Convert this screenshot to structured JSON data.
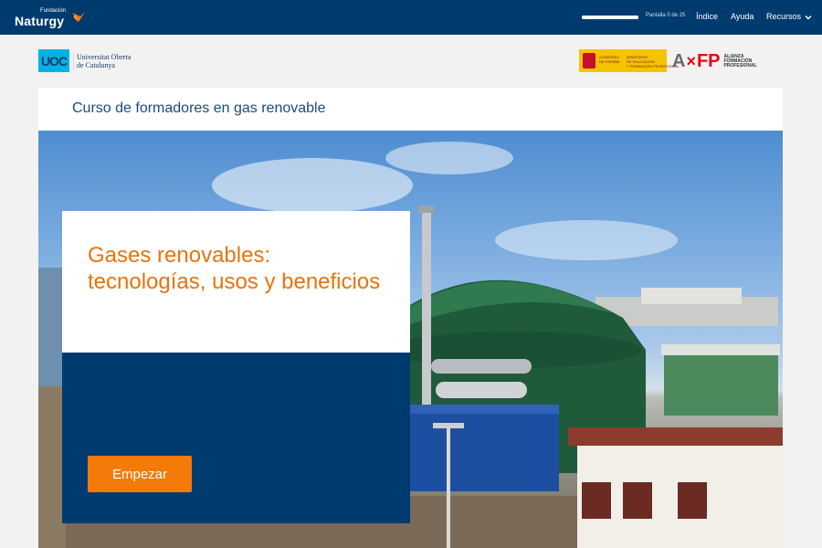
{
  "header": {
    "brand_small": "Fundación",
    "brand_name": "Naturgy",
    "progress": {
      "current": 0,
      "total": 25
    },
    "screen_count": "Pantalla 0 de 25",
    "nav": {
      "indice": "Índice",
      "ayuda": "Ayuda",
      "recursos": "Recursos"
    }
  },
  "logos": {
    "uoc_mark": "UOC",
    "uoc_line1": "Universitat Oberta",
    "uoc_line2": "de Catalunya",
    "gov_line1": "GOBIERNO",
    "gov_line2": "DE ESPAÑA",
    "ministry_line1": "MINISTERIO",
    "ministry_line2": "DE EDUCACIÓN",
    "ministry_line3": "Y FORMACIÓN PROFESIONAL",
    "afp_a": "A",
    "afp_x": "×",
    "afp_fp": "FP",
    "afp_sub1": "ALIANZA",
    "afp_sub2": "FORMACIÓN",
    "afp_sub3": "PROFESIONAL"
  },
  "course": {
    "title": "Curso de formadores en gas renovable"
  },
  "hero": {
    "heading": "Gases renovables: tecnologías, usos y beneficios",
    "start_label": "Empezar"
  },
  "colors": {
    "navy": "#003b6f",
    "orange": "#f47b0a",
    "heading_orange": "#e8730c",
    "course_title_blue": "#1a4c7a"
  }
}
